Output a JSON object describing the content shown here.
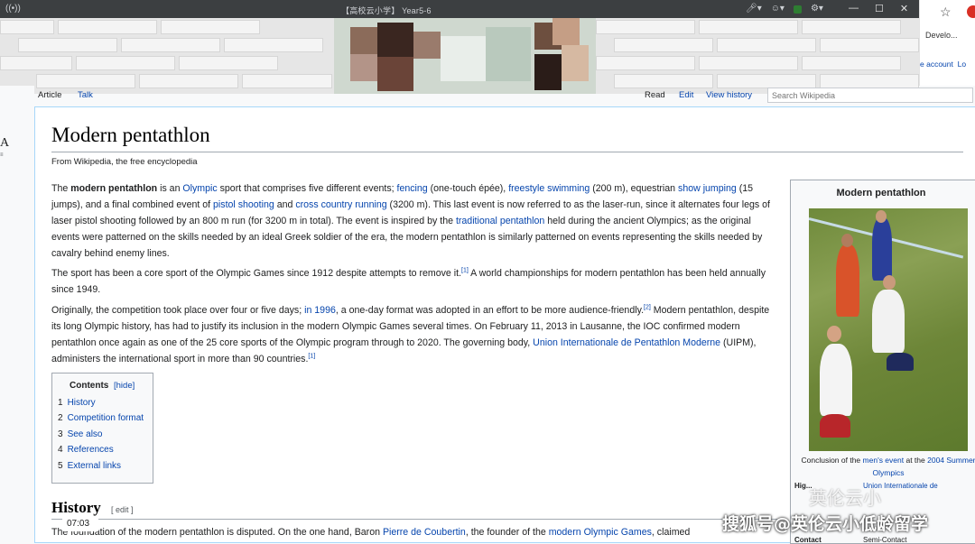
{
  "window": {
    "title": "【高校云小学】 Year5-6"
  },
  "tray_icons": [
    "mic-icon",
    "camera-icon",
    "green-status-icon",
    "settings-icon"
  ],
  "window_controls": [
    "—",
    "☐",
    "✕"
  ],
  "browser": {
    "dev_link": "Develo...",
    "account_link": "e account",
    "login_link": "Lo"
  },
  "tabs": {
    "article": "Article",
    "talk": "Talk",
    "read": "Read",
    "edit": "Edit",
    "view_history": "View history"
  },
  "search": {
    "placeholder": "Search Wikipedia"
  },
  "page": {
    "title": "Modern pentathlon",
    "tagline": "From Wikipedia, the free encyclopedia"
  },
  "p1": {
    "s1": "The ",
    "bold": "modern pentathlon",
    "s2": " is an ",
    "l_olympic": "Olympic",
    "s3": " sport that comprises five different events; ",
    "l_fencing": "fencing",
    "s4": " (one-touch épée), ",
    "l_swim": "freestyle swimming",
    "s5": " (200 m), equestrian ",
    "l_show": "show jumping",
    "s6": " (15 jumps), and a final combined event of ",
    "l_pistol": "pistol shooting",
    "s7": " and ",
    "l_cross": "cross country running",
    "s8": " (3200 m). This last event is now referred to as the laser-run, since it alternates four legs of laser pistol shooting followed by an 800 m run (for 3200 m in total). The event is inspired by the ",
    "l_trad": "traditional pentathlon",
    "s9": " held during the ancient Olympics; as the original events were patterned on the skills needed by an ideal Greek soldier of the era, the modern pentathlon is similarly patterned on events representing the skills needed by cavalry behind enemy lines."
  },
  "p2": {
    "s1": "The sport has been a core sport of the Olympic Games since 1912 despite attempts to remove it.",
    "ref1": "[1]",
    "s2": " A world championships for modern pentathlon has been held annually since 1949."
  },
  "p3": {
    "s1": "Originally, the competition took place over four or five days; ",
    "l_1996": "in 1996",
    "s2": ", a one-day format was adopted in an effort to be more audience-friendly.",
    "ref2": "[2]",
    "s3": " Modern pentathlon, despite its long Olympic history, has had to justify its inclusion in the modern Olympic Games several times. On February 11, 2013 in Lausanne, the IOC confirmed modern pentathlon once again as one of the 25 core sports of the Olympic program through to 2020. The governing body, ",
    "l_uipm": "Union Internationale de Pentathlon Moderne",
    "s4": " (UIPM), administers the international sport in more than 90 countries.",
    "ref3": "[1]"
  },
  "toc": {
    "title": "Contents",
    "hide": "[hide]",
    "items": [
      {
        "num": "1",
        "label": "History"
      },
      {
        "num": "2",
        "label": "Competition format"
      },
      {
        "num": "3",
        "label": "See also"
      },
      {
        "num": "4",
        "label": "References"
      },
      {
        "num": "5",
        "label": "External links"
      }
    ]
  },
  "history": {
    "heading": "History",
    "edit": "[ edit ]",
    "s1": "The foundation of the modern pentathlon is disputed. On the one hand, Baron ",
    "l_pierre": "Pierre de Coubertin",
    "s2": ", the founder of the ",
    "l_games": "modern Olympic Games",
    "s3": ", claimed"
  },
  "timestamp": "07:03",
  "infobox": {
    "title": "Modern pentathlon",
    "caption_1": "Conclusion of the ",
    "caption_link": "men's event",
    "caption_2": " at the ",
    "caption_link2": "2004 Summer Olympics",
    "row1_label": "Hig...",
    "row1_value": "Union Internationale de",
    "row2_label": "Contact",
    "row2_value": "Semi-Contact"
  },
  "watermark": {
    "logo": "英伦云小",
    "text": "搜狐号@英伦云小低龄留学"
  }
}
